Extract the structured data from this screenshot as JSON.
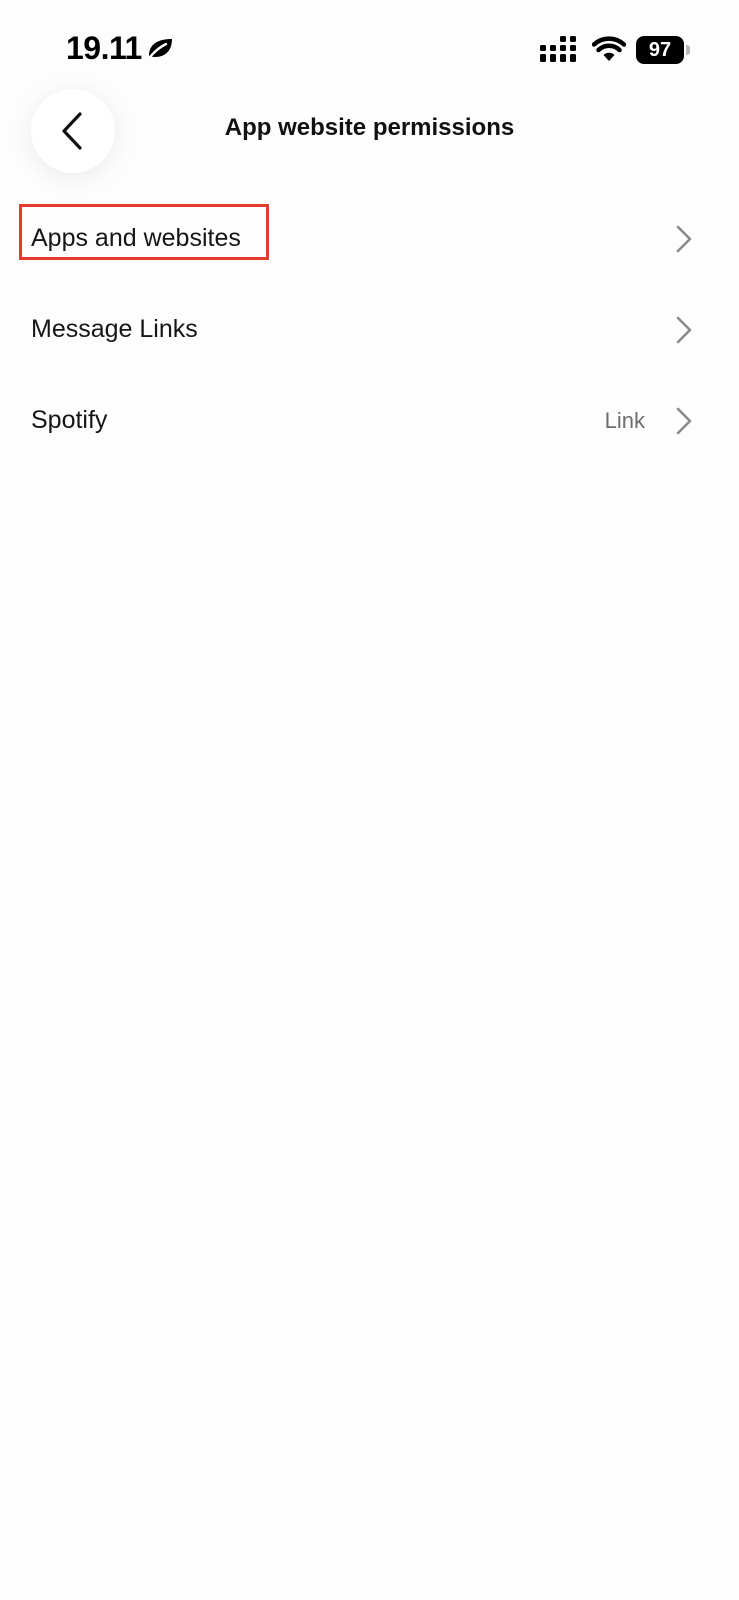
{
  "status_bar": {
    "time": "19.11",
    "battery_level": "97",
    "icons": [
      "leaf-icon",
      "cellular-signal-icon",
      "wifi-icon",
      "battery-icon"
    ]
  },
  "header": {
    "title": "App website permissions",
    "back_icon": "chevron-left-icon"
  },
  "settings_list": {
    "items": [
      {
        "label": "Apps and websites",
        "value": "",
        "icon": "chevron-right-icon",
        "highlighted": true
      },
      {
        "label": "Message Links",
        "value": "",
        "icon": "chevron-right-icon"
      },
      {
        "label": "Spotify",
        "value": "Link",
        "icon": "chevron-right-icon"
      }
    ]
  },
  "colors": {
    "background": "#fdfdfd",
    "text": "#161616",
    "secondary_text": "#6e6e6e",
    "chevron": "#8a8a8a",
    "highlight_border": "#e53b2c"
  }
}
